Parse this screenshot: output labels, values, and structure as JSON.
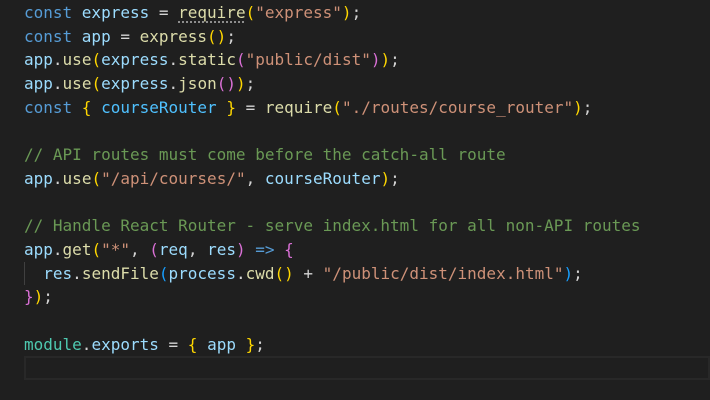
{
  "lines": [
    {
      "tokens": [
        [
          "const ",
          "kw"
        ],
        [
          "express",
          "var"
        ],
        [
          " = ",
          "op"
        ],
        [
          "require",
          "fn"
        ],
        [
          "(",
          "b1"
        ],
        [
          "\"express\"",
          "str"
        ],
        [
          ")",
          "b1"
        ],
        [
          ";",
          "op"
        ]
      ]
    },
    {
      "tokens": [
        [
          "const ",
          "kw"
        ],
        [
          "app",
          "var"
        ],
        [
          " = ",
          "op"
        ],
        [
          "express",
          "fn"
        ],
        [
          "()",
          "b1"
        ],
        [
          ";",
          "op"
        ]
      ]
    },
    {
      "tokens": [
        [
          "app",
          "var"
        ],
        [
          ".",
          "op"
        ],
        [
          "use",
          "fn"
        ],
        [
          "(",
          "b1"
        ],
        [
          "express",
          "var"
        ],
        [
          ".",
          "op"
        ],
        [
          "static",
          "fn"
        ],
        [
          "(",
          "b2"
        ],
        [
          "\"public/dist\"",
          "str"
        ],
        [
          ")",
          "b2"
        ],
        [
          ")",
          "b1"
        ],
        [
          ";",
          "op"
        ]
      ]
    },
    {
      "tokens": [
        [
          "app",
          "var"
        ],
        [
          ".",
          "op"
        ],
        [
          "use",
          "fn"
        ],
        [
          "(",
          "b1"
        ],
        [
          "express",
          "var"
        ],
        [
          ".",
          "op"
        ],
        [
          "json",
          "fn"
        ],
        [
          "()",
          "b2"
        ],
        [
          ")",
          "b1"
        ],
        [
          ";",
          "op"
        ]
      ]
    },
    {
      "tokens": [
        [
          "const ",
          "kw"
        ],
        [
          "{",
          "b1"
        ],
        [
          " ",
          "op"
        ],
        [
          "courseRouter",
          "cvar"
        ],
        [
          " ",
          "op"
        ],
        [
          "}",
          "b1"
        ],
        [
          " = ",
          "op"
        ],
        [
          "require",
          "fn"
        ],
        [
          "(",
          "b1"
        ],
        [
          "\"./routes/course_router\"",
          "str"
        ],
        [
          ")",
          "b1"
        ],
        [
          ";",
          "op"
        ]
      ]
    },
    {
      "tokens": []
    },
    {
      "tokens": [
        [
          "// API routes must come before the catch-all route",
          "cm"
        ]
      ]
    },
    {
      "tokens": [
        [
          "app",
          "var"
        ],
        [
          ".",
          "op"
        ],
        [
          "use",
          "fn"
        ],
        [
          "(",
          "b1"
        ],
        [
          "\"/api/courses/\"",
          "str"
        ],
        [
          ", ",
          "op"
        ],
        [
          "courseRouter",
          "var"
        ],
        [
          ")",
          "b1"
        ],
        [
          ";",
          "op"
        ]
      ]
    },
    {
      "tokens": []
    },
    {
      "tokens": [
        [
          "// Handle React Router - serve index.html for all non-API routes",
          "cm"
        ]
      ]
    },
    {
      "tokens": [
        [
          "app",
          "var"
        ],
        [
          ".",
          "op"
        ],
        [
          "get",
          "fn"
        ],
        [
          "(",
          "b1"
        ],
        [
          "\"*\"",
          "str"
        ],
        [
          ", ",
          "op"
        ],
        [
          "(",
          "b2"
        ],
        [
          "req",
          "param"
        ],
        [
          ", ",
          "op"
        ],
        [
          "res",
          "param"
        ],
        [
          ")",
          "b2"
        ],
        [
          " => ",
          "kw"
        ],
        [
          "{",
          "b2"
        ]
      ]
    },
    {
      "tokens": [
        [
          "  ",
          "op"
        ],
        [
          "res",
          "var"
        ],
        [
          ".",
          "op"
        ],
        [
          "sendFile",
          "fn"
        ],
        [
          "(",
          "b3"
        ],
        [
          "process",
          "var"
        ],
        [
          ".",
          "op"
        ],
        [
          "cwd",
          "fn"
        ],
        [
          "()",
          "b1"
        ],
        [
          " + ",
          "op"
        ],
        [
          "\"/public/dist/index.html\"",
          "str"
        ],
        [
          ")",
          "b3"
        ],
        [
          ";",
          "op"
        ]
      ],
      "guide": true
    },
    {
      "tokens": [
        [
          "}",
          "b2"
        ],
        [
          ")",
          "b1"
        ],
        [
          ";",
          "op"
        ]
      ]
    },
    {
      "tokens": []
    },
    {
      "tokens": [
        [
          "module",
          "mod"
        ],
        [
          ".",
          "op"
        ],
        [
          "exports",
          "var"
        ],
        [
          " = ",
          "op"
        ],
        [
          "{",
          "b1"
        ],
        [
          " ",
          "op"
        ],
        [
          "app",
          "var"
        ],
        [
          " ",
          "op"
        ],
        [
          "}",
          "b1"
        ],
        [
          ";",
          "op"
        ]
      ]
    },
    {
      "tokens": [],
      "current": true
    }
  ]
}
